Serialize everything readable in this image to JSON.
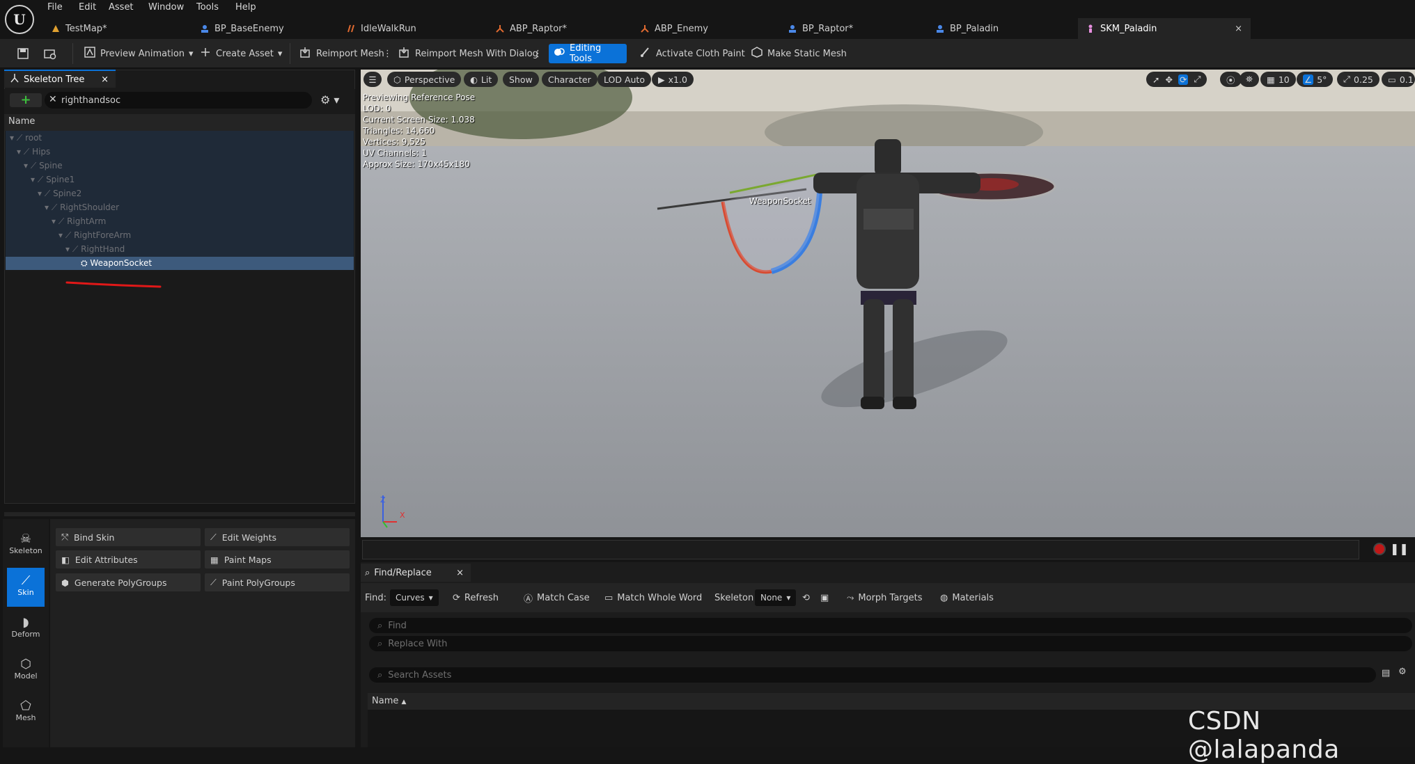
{
  "menu": [
    "File",
    "Edit",
    "Asset",
    "Window",
    "Tools",
    "Help"
  ],
  "tabs": [
    {
      "label": "TestMap*",
      "icon": "map-icon",
      "color": "#e0a030"
    },
    {
      "label": "BP_BaseEnemy",
      "icon": "blueprint-icon",
      "color": "#4a88e8"
    },
    {
      "label": "IdleWalkRun",
      "icon": "blendspace-icon",
      "color": "#e06a30"
    },
    {
      "label": "ABP_Raptor*",
      "icon": "anim-blueprint-icon",
      "color": "#e06a30"
    },
    {
      "label": "ABP_Enemy",
      "icon": "anim-blueprint-icon",
      "color": "#e06a30"
    },
    {
      "label": "BP_Raptor*",
      "icon": "blueprint-icon",
      "color": "#4a88e8"
    },
    {
      "label": "BP_Paladin",
      "icon": "blueprint-icon",
      "color": "#4a88e8"
    },
    {
      "label": "SKM_Paladin",
      "icon": "skeletal-mesh-icon",
      "color": "#e890e0",
      "close": "×"
    }
  ],
  "toolbar": {
    "preview_animation": "Preview Animation",
    "create_asset": "Create Asset",
    "reimport_mesh": "Reimport Mesh",
    "reimport_mesh_dialog": "Reimport Mesh With Dialog",
    "editing_tools": "Editing Tools",
    "activate_cloth_paint": "Activate Cloth Paint",
    "make_static_mesh": "Make Static Mesh"
  },
  "skeleton_tree": {
    "tab_title": "Skeleton Tree",
    "close": "×",
    "search_value": "righthandsoc",
    "column_name": "Name",
    "bones": [
      {
        "name": "root",
        "depth": 0
      },
      {
        "name": "Hips",
        "depth": 1
      },
      {
        "name": "Spine",
        "depth": 2
      },
      {
        "name": "Spine1",
        "depth": 3
      },
      {
        "name": "Spine2",
        "depth": 4
      },
      {
        "name": "RightShoulder",
        "depth": 5
      },
      {
        "name": "RightArm",
        "depth": 6
      },
      {
        "name": "RightForeArm",
        "depth": 7
      },
      {
        "name": "RightHand",
        "depth": 8
      }
    ],
    "socket": "WeaponSocket"
  },
  "tool_palette": {
    "categories": [
      "Skeleton",
      "Skin",
      "Deform",
      "Model",
      "Mesh"
    ],
    "active_category": "Skin",
    "buttons": [
      "Bind Skin",
      "Edit Weights",
      "Edit Attributes",
      "Paint Maps",
      "Generate PolyGroups",
      "Paint PolyGroups"
    ]
  },
  "viewport": {
    "pills": [
      "Perspective",
      "Lit",
      "Show",
      "Character",
      "LOD Auto",
      "x1.0"
    ],
    "info": [
      "Previewing Reference Pose",
      "LOD: 0",
      "Current Screen Size: 1.038",
      "Triangles: 14,660",
      "Vertices: 9,525",
      "UV Channels: 1",
      "Approx Size: 170x45x180"
    ],
    "socket_label": "WeaponSocket",
    "grid_value": "10",
    "angle_value": "5°",
    "scale_value": "0.25",
    "camera_value": "0.1",
    "axis_z": "Z",
    "axis_x": "X"
  },
  "find_replace": {
    "tab_title": "Find/Replace",
    "close": "×",
    "find_label": "Find:",
    "find_mode": "Curves",
    "refresh": "Refresh",
    "match_case": "Match Case",
    "match_whole_word": "Match Whole Word",
    "skeleton_label": "Skeleton",
    "skeleton_value": "None",
    "morph_targets": "Morph Targets",
    "materials": "Materials",
    "find_placeholder": "Find",
    "replace_placeholder": "Replace With",
    "search_assets_placeholder": "Search Assets",
    "column_name": "Name"
  },
  "watermark": "CSDN @lalapanda"
}
